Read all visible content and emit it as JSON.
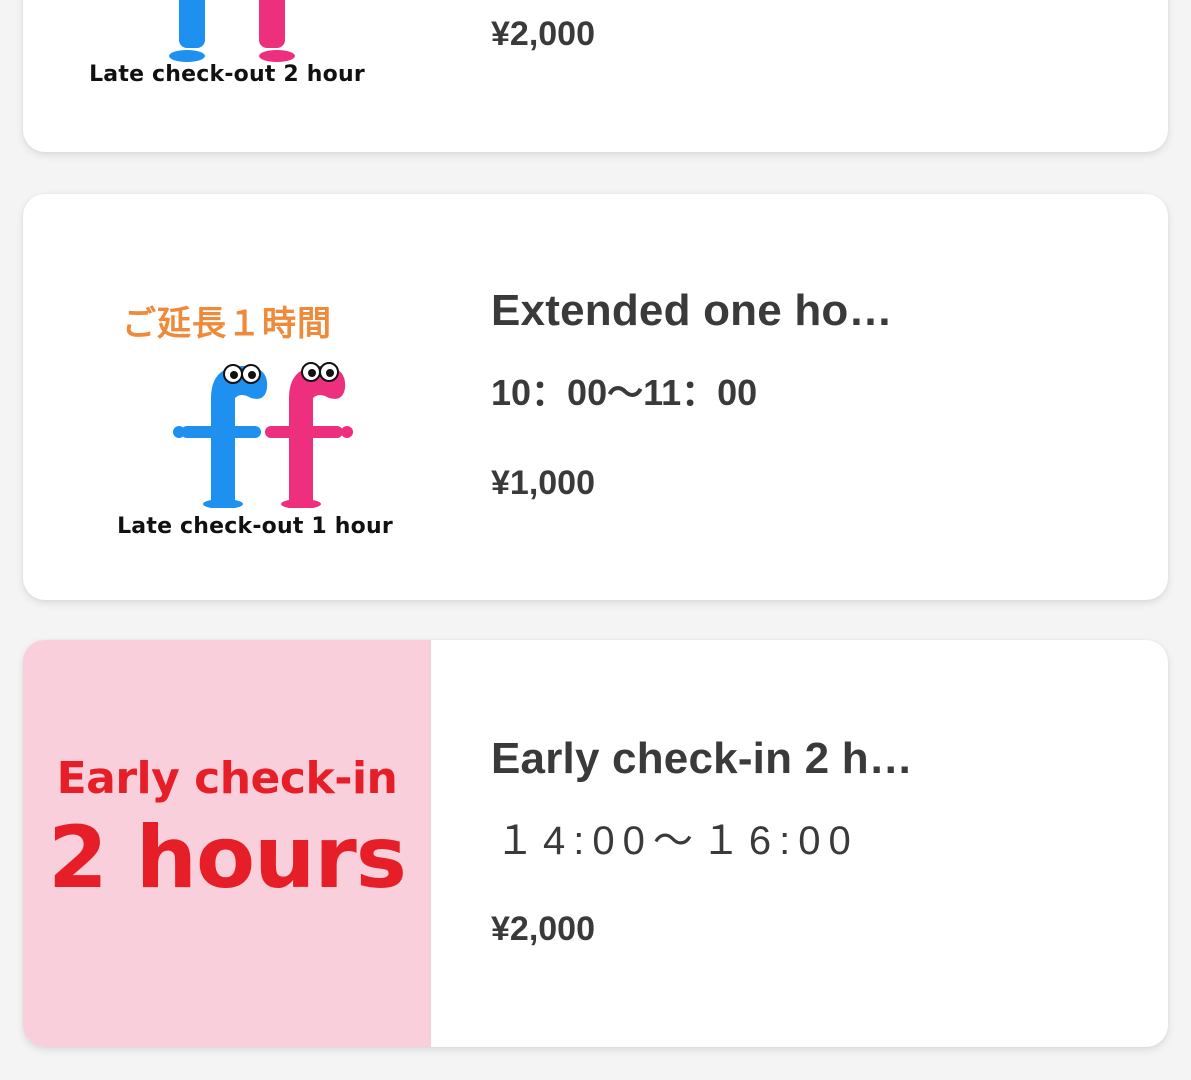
{
  "products": [
    {
      "image_caption": "Late check-out 2 hour",
      "price": "¥2,000"
    },
    {
      "image_title_jp": "ご延長１時間",
      "image_caption": "Late check-out 1 hour",
      "title": "Extended one ho…",
      "time": "10：00〜11：00",
      "price": "¥1,000"
    },
    {
      "image_line1": "Early check-in",
      "image_line2": "2 hours",
      "title": "Early check-in 2 h…",
      "time": "１4:00〜１6:00",
      "price": "¥2,000"
    }
  ],
  "colors": {
    "mascot_blue": "#1e90f0",
    "mascot_pink": "#ee2f7e",
    "jp_title_orange": "#ef8a3a",
    "early_bg": "#f8cfda",
    "early_text": "#e61e28"
  }
}
